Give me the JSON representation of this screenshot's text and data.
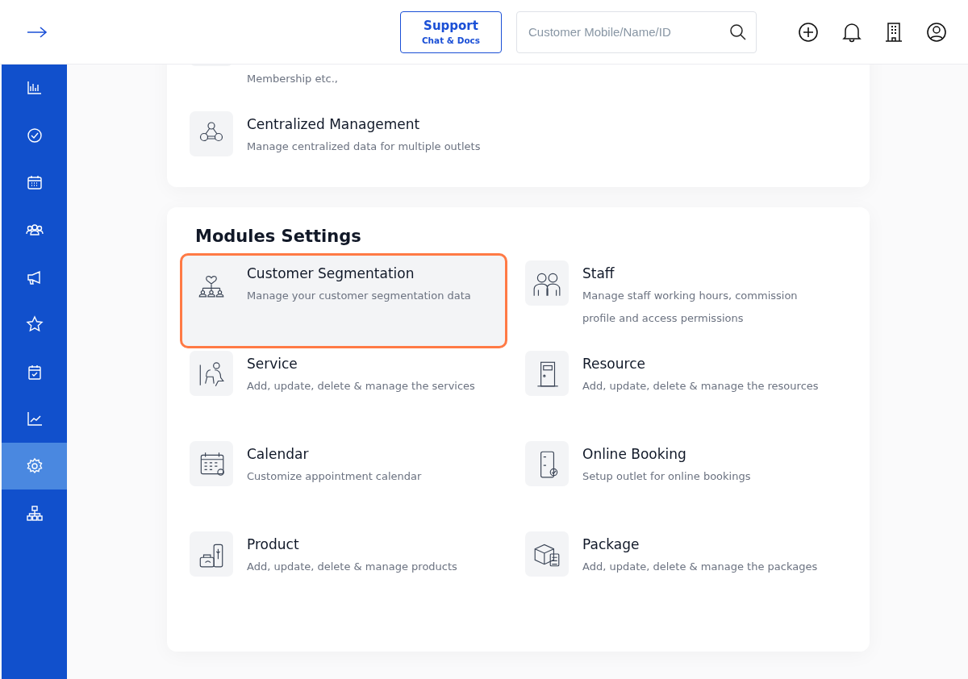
{
  "header": {
    "support": {
      "title": "Support",
      "subtitle": "Chat & Docs"
    },
    "search": {
      "placeholder": "Customer Mobile/Name/ID"
    }
  },
  "sidebar": {
    "items": [
      {
        "selected": false
      },
      {
        "selected": false
      },
      {
        "selected": false
      },
      {
        "selected": false
      },
      {
        "selected": false
      },
      {
        "selected": false
      },
      {
        "selected": false
      },
      {
        "selected": false
      },
      {
        "selected": true
      },
      {
        "selected": false
      }
    ]
  },
  "general_card": {
    "items": [
      {
        "description": "Membership etc.,"
      },
      {
        "title": "Centralized Management",
        "description": "Manage centralized data for multiple outlets"
      }
    ]
  },
  "modules": {
    "heading": "Modules Settings",
    "items": [
      {
        "title": "Customer Segmentation",
        "description": "Manage your customer segmentation data",
        "highlighted": true
      },
      {
        "title": "Staff",
        "description": "Manage staff working hours, commission profile and access permissions",
        "highlighted": false
      },
      {
        "title": "Service",
        "description": "Add, update, delete & manage the services",
        "highlighted": false
      },
      {
        "title": "Resource",
        "description": "Add, update, delete & manage the resources",
        "highlighted": false
      },
      {
        "title": "Calendar",
        "description": "Customize appointment calendar",
        "highlighted": false
      },
      {
        "title": "Online Booking",
        "description": "Setup outlet for online bookings",
        "highlighted": false
      },
      {
        "title": "Product",
        "description": "Add, update, delete & manage products",
        "highlighted": false
      },
      {
        "title": "Package",
        "description": "Add, update, delete & manage the packages",
        "highlighted": false
      }
    ]
  }
}
